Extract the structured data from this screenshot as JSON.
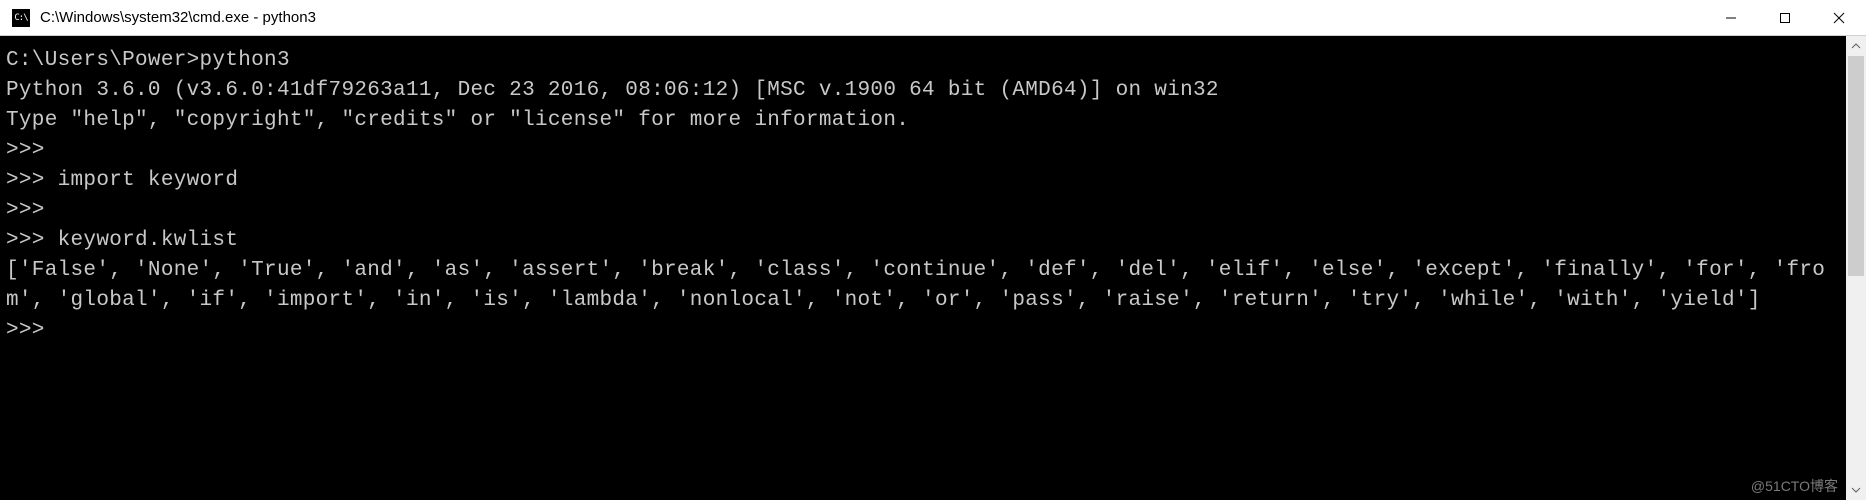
{
  "window": {
    "title": "C:\\Windows\\system32\\cmd.exe - python3",
    "app_icon_label": "C:\\"
  },
  "terminal": {
    "lines": [
      "C:\\Users\\Power>python3",
      "Python 3.6.0 (v3.6.0:41df79263a11, Dec 23 2016, 08:06:12) [MSC v.1900 64 bit (AMD64)] on win32",
      "Type \"help\", \"copyright\", \"credits\" or \"license\" for more information.",
      ">>>",
      ">>> import keyword",
      ">>>",
      ">>> keyword.kwlist",
      "['False', 'None', 'True', 'and', 'as', 'assert', 'break', 'class', 'continue', 'def', 'del', 'elif', 'else', 'except', 'finally', 'for', 'from', 'global', 'if', 'import', 'in', 'is', 'lambda', 'nonlocal', 'not', 'or', 'pass', 'raise', 'return', 'try', 'while', 'with', 'yield']",
      ">>>"
    ]
  },
  "watermark": "@51CTO博客"
}
